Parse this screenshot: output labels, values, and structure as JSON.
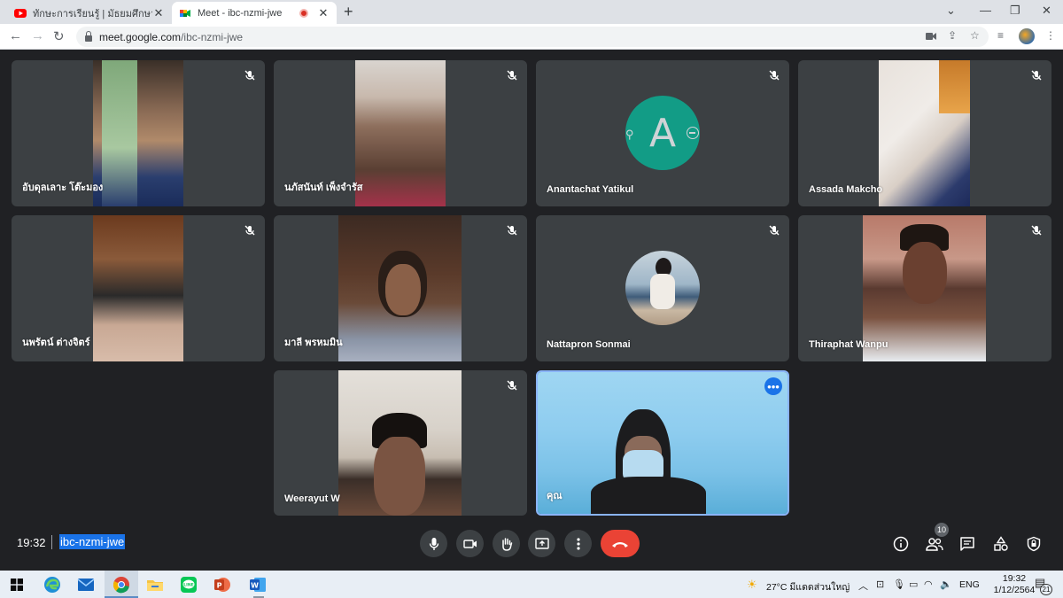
{
  "browser": {
    "tabs": [
      {
        "title": "ทักษะการเรียนรู้ | มัธยมศึกษาตอนต้น..."
      },
      {
        "title": "Meet - ibc-nzmi-jwe"
      }
    ],
    "url_host": "meet.google.com",
    "url_path": "/ibc-nzmi-jwe"
  },
  "participants": [
    {
      "name": "อับดุลเลาะ โต๊ะมอง"
    },
    {
      "name": "นภัสนันท์ เพ็งจำรัส"
    },
    {
      "name": "Anantachat Yatikul",
      "avatar_letter": "A"
    },
    {
      "name": "Assada Makcho"
    },
    {
      "name": "นพรัตน์ ต่างจิตร์"
    },
    {
      "name": "มาลี พรหมมิน"
    },
    {
      "name": "Nattapron Sonmai"
    },
    {
      "name": "Thiraphat Wanpu"
    },
    {
      "name": "Weerayut W"
    },
    {
      "name": "คุณ"
    }
  ],
  "meeting": {
    "time": "19:32",
    "code": "ibc-nzmi-jwe",
    "people_count": "10"
  },
  "colors": {
    "meet_bg": "#202124",
    "tile_bg": "#3c4043",
    "end_call": "#ea4335",
    "highlight": "#1a73e8",
    "avatar_teal": "#129c86"
  },
  "taskbar": {
    "weather": "27°C  มีแดดส่วนใหญ่",
    "language": "ENG",
    "time": "19:32",
    "date": "1/12/2564",
    "notification_count": "21"
  }
}
